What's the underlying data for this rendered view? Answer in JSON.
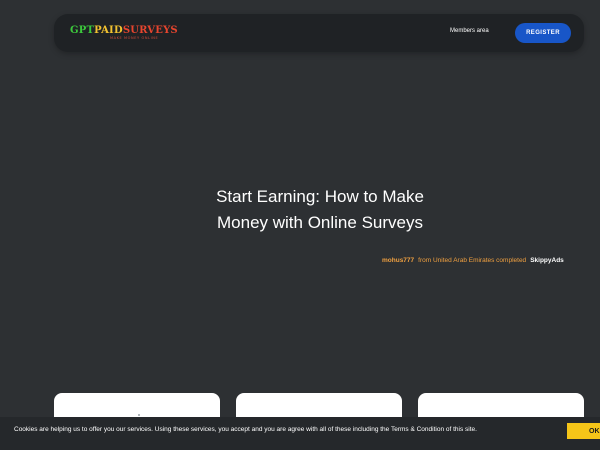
{
  "header": {
    "logo": {
      "part1": "GPT",
      "part2": "PAID",
      "part3": "SURVEYS",
      "tagline": "MAKE MONEY ONLINE"
    },
    "members_link": "Members area",
    "register_label": "REGISTER"
  },
  "hero": {
    "title_line1": "Start Earning: How to Make",
    "title_line2": "Money with Online Surveys"
  },
  "ticker": {
    "username": "mohus777",
    "text": "from United Arab Emirates completed",
    "offer": "SkippyAds"
  },
  "cookie": {
    "text": "Cookies are helping us to offer you our services. Using these services, you accept and you are agree with all of these including the Terms & Condition of this site.",
    "ok_label": "OK"
  },
  "colors": {
    "background": "#2d3033",
    "navbar": "#1f2225",
    "register_button": "#1856c8",
    "ok_button": "#f5c518",
    "ticker_accent": "#f0a040"
  }
}
